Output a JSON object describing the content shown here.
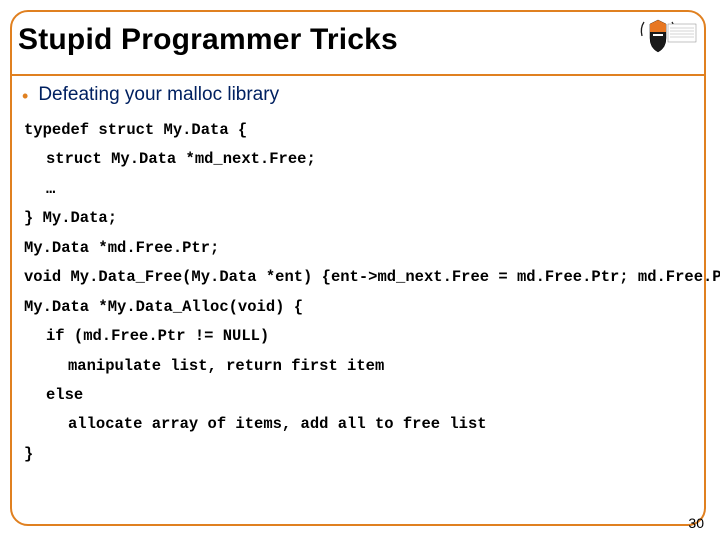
{
  "title": "Stupid Programmer Tricks",
  "bullet": "Defeating your malloc library",
  "code": {
    "l1": "typedef struct My.Data {",
    "l2": "struct My.Data *md_next.Free;",
    "l3": "…",
    "l4": "} My.Data;",
    "l5": "My.Data *md.Free.Ptr;",
    "l6": "void My.Data_Free(My.Data *ent) {ent->md_next.Free = md.Free.Ptr; md.Free.Ptr = ent;}",
    "l7": "My.Data *My.Data_Alloc(void) {",
    "l8": "if (md.Free.Ptr != NULL)",
    "l9": "manipulate list, return first item",
    "l10": "else",
    "l11": "allocate array of items, add all to free list",
    "l12": "}"
  },
  "page_number": "30"
}
